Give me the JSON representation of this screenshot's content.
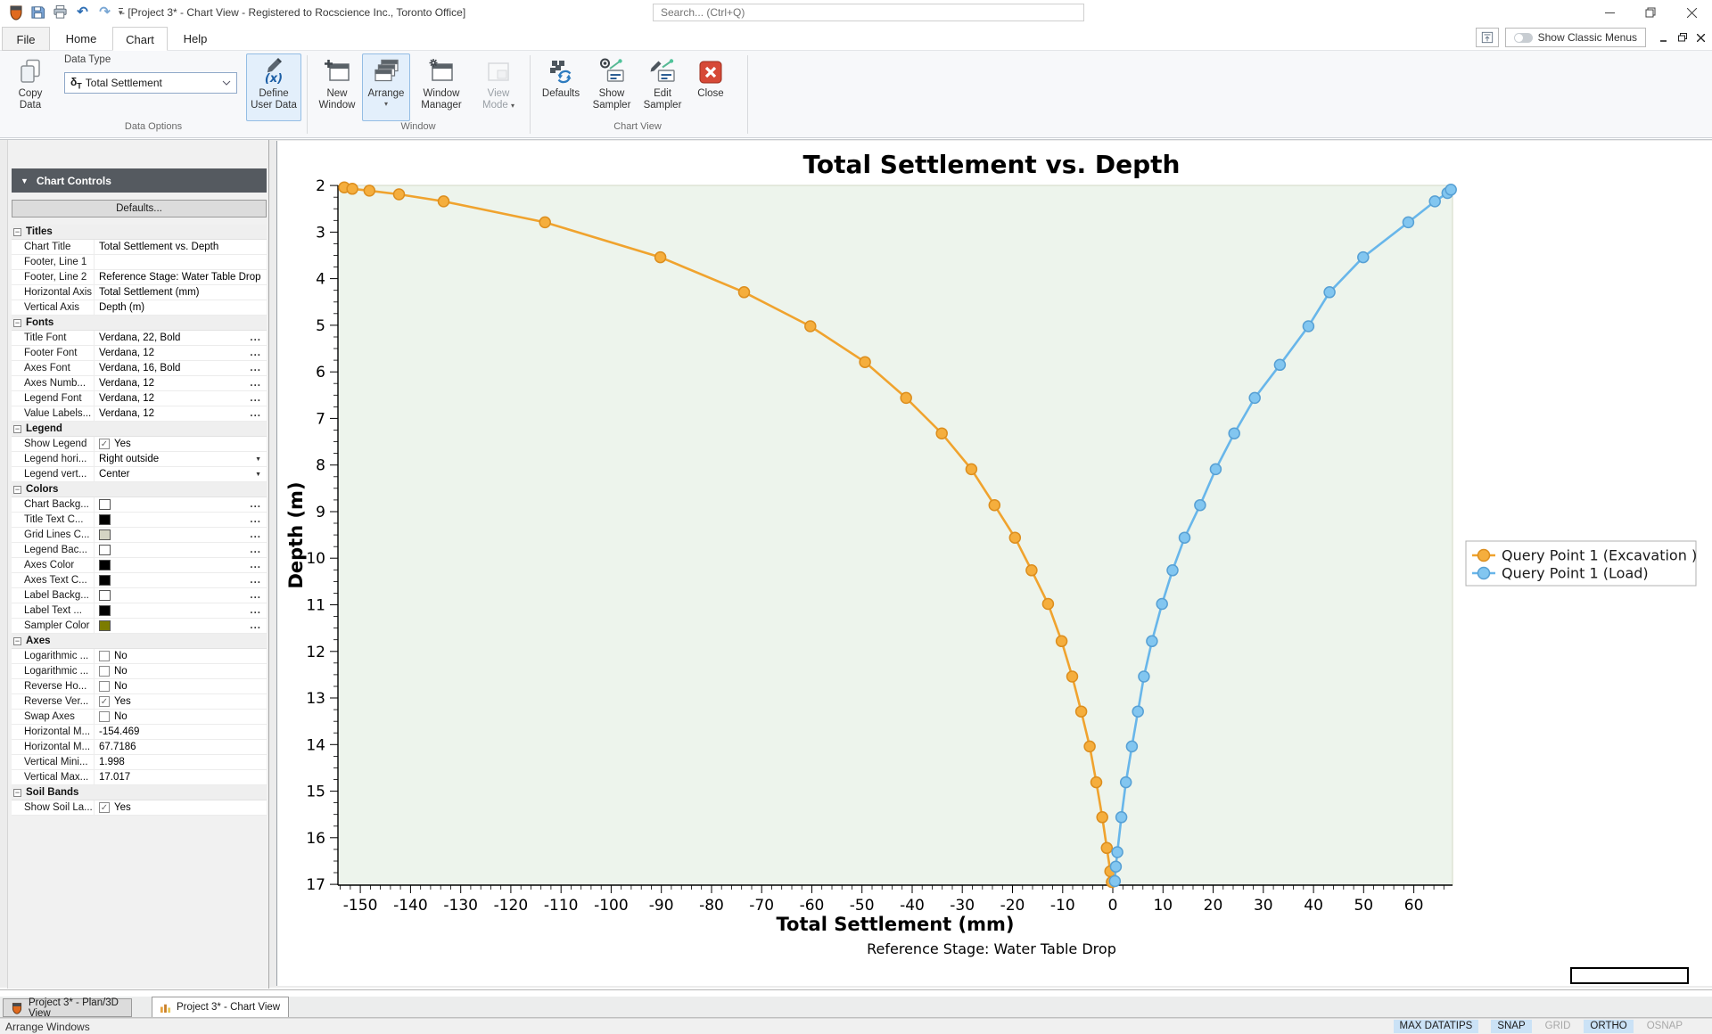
{
  "window": {
    "title": "- [Project 3* - Chart View - Registered to Rocscience Inc., Toronto Office]",
    "search_placeholder": "Search... (Ctrl+Q)",
    "classic_menus_label": "Show Classic Menus"
  },
  "ribbon_tabs": {
    "items": [
      "File",
      "Home",
      "Chart",
      "Help"
    ],
    "active": "Chart"
  },
  "ribbon": {
    "group_labels": [
      "Data Options",
      "Window",
      "Chart View"
    ],
    "data_type_label": "Data Type",
    "data_type_symbol": "δ",
    "data_type_symbol_sub": "T",
    "data_type_value": "Total Settlement",
    "buttons": {
      "copy_data": "Copy\nData",
      "define_user_data": "Define\nUser Data",
      "new_window": "New\nWindow",
      "arrange": "Arrange",
      "window_manager": "Window\nManager",
      "view_mode": "View\nMode",
      "defaults": "Defaults",
      "show_sampler": "Show\nSampler",
      "edit_sampler": "Edit\nSampler",
      "close": "Close"
    }
  },
  "icons": {
    "undo": "↶",
    "redo": "↷",
    "qat_caret": "▾",
    "header_triangle": "▼",
    "small_caret": "▾",
    "check": "✓",
    "dropdown_arrow": "▼",
    "ellipsis": "...",
    "minimize": "—",
    "close_x": "✕"
  },
  "panel": {
    "header": "Chart Controls",
    "defaults_button": "Defaults...",
    "sections": [
      {
        "title": "Titles",
        "rows": [
          {
            "label": "Chart Title",
            "value": "Total Settlement vs. Depth",
            "type": "text"
          },
          {
            "label": "Footer, Line 1",
            "value": "",
            "type": "text"
          },
          {
            "label": "Footer, Line 2",
            "value": "Reference Stage: Water Table Drop",
            "type": "text"
          },
          {
            "label": "Horizontal Axis",
            "value": "Total Settlement (mm)",
            "type": "text"
          },
          {
            "label": "Vertical Axis",
            "value": "Depth (m)",
            "type": "text"
          }
        ]
      },
      {
        "title": "Fonts",
        "rows": [
          {
            "label": "Title Font",
            "value": "Verdana, 22, Bold",
            "type": "ellipsis"
          },
          {
            "label": "Footer Font",
            "value": "Verdana, 12",
            "type": "ellipsis"
          },
          {
            "label": "Axes Font",
            "value": "Verdana, 16, Bold",
            "type": "ellipsis"
          },
          {
            "label": "Axes Numb...",
            "value": "Verdana, 12",
            "type": "ellipsis"
          },
          {
            "label": "Legend Font",
            "value": "Verdana, 12",
            "type": "ellipsis"
          },
          {
            "label": "Value Labels...",
            "value": "Verdana, 12",
            "type": "ellipsis"
          }
        ]
      },
      {
        "title": "Legend",
        "rows": [
          {
            "label": "Show Legend",
            "value": "Yes",
            "type": "check",
            "checked": true
          },
          {
            "label": "Legend hori...",
            "value": "Right outside",
            "type": "dropdown"
          },
          {
            "label": "Legend vert...",
            "value": "Center",
            "type": "dropdown"
          }
        ]
      },
      {
        "title": "Colors",
        "rows": [
          {
            "label": "Chart Backg...",
            "value": "",
            "type": "swatch",
            "swatch": "#ffffff"
          },
          {
            "label": "Title Text C...",
            "value": "",
            "type": "swatch",
            "swatch": "#000000"
          },
          {
            "label": "Grid Lines C...",
            "value": "",
            "type": "swatch",
            "swatch": "#d4d4c4"
          },
          {
            "label": "Legend Bac...",
            "value": "",
            "type": "swatch",
            "swatch": "#ffffff"
          },
          {
            "label": "Axes Color",
            "value": "",
            "type": "swatch",
            "swatch": "#000000"
          },
          {
            "label": "Axes Text C...",
            "value": "",
            "type": "swatch",
            "swatch": "#000000"
          },
          {
            "label": "Label Backg...",
            "value": "",
            "type": "swatch",
            "swatch": "#ffffff"
          },
          {
            "label": "Label Text ...",
            "value": "",
            "type": "swatch",
            "swatch": "#000000"
          },
          {
            "label": "Sampler Color",
            "value": "",
            "type": "swatch",
            "swatch": "#7c7c00"
          }
        ]
      },
      {
        "title": "Axes",
        "rows": [
          {
            "label": "Logarithmic ...",
            "value": "No",
            "type": "check",
            "checked": false
          },
          {
            "label": "Logarithmic ...",
            "value": "No",
            "type": "check",
            "checked": false
          },
          {
            "label": "Reverse Ho...",
            "value": "No",
            "type": "check",
            "checked": false
          },
          {
            "label": "Reverse Ver...",
            "value": "Yes",
            "type": "check",
            "checked": true
          },
          {
            "label": "Swap Axes",
            "value": "No",
            "type": "check",
            "checked": false
          },
          {
            "label": "Horizontal M...",
            "value": "-154.469",
            "type": "text"
          },
          {
            "label": "Horizontal M...",
            "value": "67.7186",
            "type": "text"
          },
          {
            "label": "Vertical Mini...",
            "value": "1.998",
            "type": "text"
          },
          {
            "label": "Vertical Max...",
            "value": "17.017",
            "type": "text"
          }
        ]
      },
      {
        "title": "Soil Bands",
        "rows": [
          {
            "label": "Show Soil La...",
            "value": "Yes",
            "type": "check",
            "checked": true
          }
        ]
      }
    ]
  },
  "chart_data": {
    "type": "line",
    "title": "Total Settlement vs. Depth",
    "xlabel": "Total Settlement (mm)",
    "ylabel": "Depth (m)",
    "footer": "Reference Stage: Water Table Drop",
    "x_min": -154.469,
    "x_max": 67.7186,
    "y_min": 1.998,
    "y_max": 17.017,
    "y_axis_reversed": true,
    "x_ticks": [
      -150,
      -140,
      -130,
      -120,
      -110,
      -100,
      -90,
      -80,
      -70,
      -60,
      -50,
      -40,
      -30,
      -20,
      -10,
      0,
      10,
      20,
      30,
      40,
      50,
      60
    ],
    "y_ticks": [
      2,
      3,
      4,
      5,
      6,
      7,
      8,
      9,
      10,
      11,
      12,
      13,
      14,
      15,
      16,
      17
    ],
    "x_minor_step": 2,
    "y_minor_step": 0.25,
    "grid": false,
    "plot_bg": "#edf4ec",
    "legend_position": "right outside center",
    "series": [
      {
        "name": "Query Point 1 (Excavation )",
        "color": "#F0A32E",
        "marker_fill": "#F5AE3D",
        "marker_stroke": "#DC8E1E",
        "points": [
          [
            -153.2,
            2.04
          ],
          [
            -151.6,
            2.07
          ],
          [
            -148.2,
            2.11
          ],
          [
            -142.3,
            2.19
          ],
          [
            -133.4,
            2.34
          ],
          [
            -113.2,
            2.79
          ],
          [
            -90.2,
            3.54
          ],
          [
            -73.5,
            4.29
          ],
          [
            -60.3,
            5.02
          ],
          [
            -49.4,
            5.79
          ],
          [
            -41.2,
            6.56
          ],
          [
            -34.1,
            7.32
          ],
          [
            -28.2,
            8.09
          ],
          [
            -23.6,
            8.86
          ],
          [
            -19.5,
            9.56
          ],
          [
            -16.2,
            10.26
          ],
          [
            -12.9,
            10.98
          ],
          [
            -10.2,
            11.78
          ],
          [
            -8.1,
            12.54
          ],
          [
            -6.3,
            13.29
          ],
          [
            -4.6,
            14.04
          ],
          [
            -3.3,
            14.81
          ],
          [
            -2.1,
            15.56
          ],
          [
            -1.2,
            16.22
          ],
          [
            -0.5,
            16.72
          ],
          [
            -0.2,
            16.95
          ]
        ]
      },
      {
        "name": "Query Point 1 (Load)",
        "color": "#68B6EA",
        "marker_fill": "#82C6F0",
        "marker_stroke": "#57A0D4",
        "points": [
          [
            0.4,
            16.93
          ],
          [
            0.6,
            16.62
          ],
          [
            0.9,
            16.31
          ],
          [
            1.7,
            15.56
          ],
          [
            2.6,
            14.81
          ],
          [
            3.8,
            14.04
          ],
          [
            5.0,
            13.29
          ],
          [
            6.2,
            12.54
          ],
          [
            7.8,
            11.78
          ],
          [
            9.8,
            10.98
          ],
          [
            11.9,
            10.26
          ],
          [
            14.3,
            9.56
          ],
          [
            17.4,
            8.86
          ],
          [
            20.5,
            8.09
          ],
          [
            24.2,
            7.32
          ],
          [
            28.3,
            6.56
          ],
          [
            33.3,
            5.85
          ],
          [
            39.0,
            5.02
          ],
          [
            43.2,
            4.29
          ],
          [
            49.9,
            3.54
          ],
          [
            58.9,
            2.79
          ],
          [
            64.2,
            2.34
          ],
          [
            66.7,
            2.16
          ],
          [
            67.4,
            2.09
          ]
        ]
      }
    ]
  },
  "window_tabs": [
    {
      "label": "Project 3* - Plan/3D View",
      "active": false
    },
    {
      "label": "Project 3* - Chart View",
      "active": true
    }
  ],
  "status_bar": {
    "hint": "Arrange Windows",
    "toggles": [
      {
        "label": "MAX DATATIPS",
        "on": true
      },
      {
        "label": "SNAP",
        "on": true
      },
      {
        "label": "GRID",
        "on": false
      },
      {
        "label": "ORTHO",
        "on": true
      },
      {
        "label": "OSNAP",
        "on": false
      }
    ]
  }
}
